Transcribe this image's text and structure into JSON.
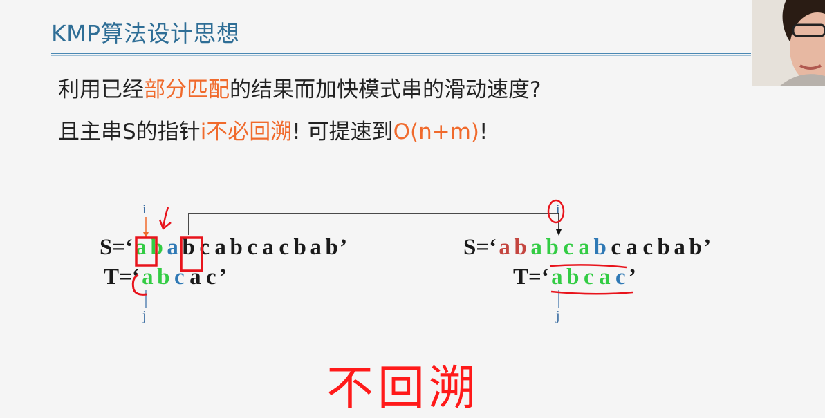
{
  "slide": {
    "title": "KMP算法设计思想",
    "line1": {
      "pre": "利用已经",
      "highlight": "部分匹配",
      "post": "的结果而加快模式串的滑动速度?"
    },
    "line2": {
      "pre": "且主串S的指针",
      "highlight1": "i不必回溯",
      "mid": "! 可提速到",
      "highlight2": "O(n+m)",
      "post": "!"
    }
  },
  "left_example": {
    "s_prefix": "S=‘",
    "s_chars": [
      "a",
      "b",
      "a",
      "b",
      "c",
      "a",
      "b",
      "c",
      "a",
      "c",
      "b",
      "a",
      "b"
    ],
    "s_suffix": "’",
    "t_prefix": "T=‘",
    "t_chars": [
      "a",
      "b",
      "c",
      "a",
      "c"
    ],
    "t_suffix": "’",
    "i_label": "i",
    "j_label": "j"
  },
  "right_example": {
    "s_prefix": "S=‘",
    "s_chars": [
      "a",
      "b",
      "a",
      "b",
      "c",
      "a",
      "b",
      "c",
      "a",
      "c",
      "b",
      "a",
      "b"
    ],
    "s_suffix": "’",
    "t_prefix": "T=‘",
    "t_chars": [
      "a",
      "b",
      "c",
      "a",
      "c"
    ],
    "t_suffix": "’",
    "i_label": "i",
    "j_label": "j"
  },
  "subtitle": "不回溯",
  "colors": {
    "title": "#2f6e96",
    "highlight": "#f06a2c",
    "match_green": "#33cc44",
    "mismatch_blue": "#2f79b5",
    "skipped_red": "#c4453f",
    "annotation_red": "#e8141c",
    "subtitle_red": "#ff1a1a"
  }
}
